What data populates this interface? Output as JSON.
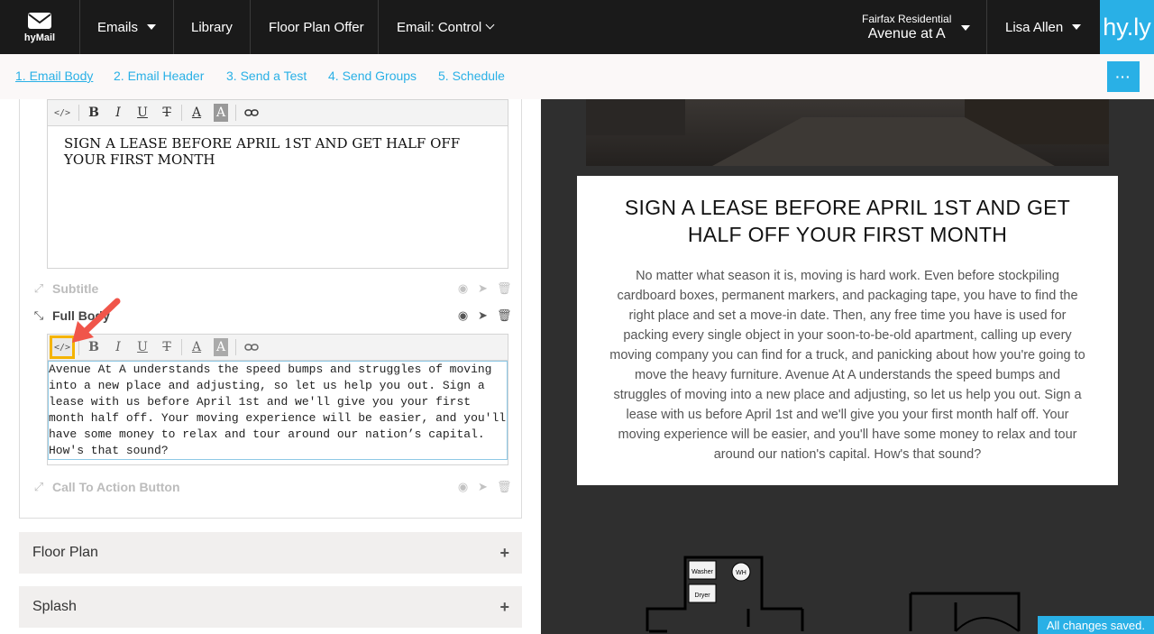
{
  "topbar": {
    "logo_label": "hyMail",
    "emails_label": "Emails",
    "library_label": "Library",
    "offer_label": "Floor Plan Offer",
    "email_variant_label": "Email: Control",
    "org_name": "Fairfax Residential",
    "property_name": "Avenue at A",
    "user_name": "Lisa Allen",
    "brand": "hy.ly"
  },
  "tabs": [
    {
      "label": "1. Email Body",
      "active": true
    },
    {
      "label": "2. Email Header",
      "active": false
    },
    {
      "label": "3. Send a Test",
      "active": false
    },
    {
      "label": "4. Send Groups",
      "active": false
    },
    {
      "label": "5. Schedule",
      "active": false
    }
  ],
  "more_button": "···",
  "editor": {
    "title_text": "SIGN A LEASE BEFORE APRIL 1ST AND GET HALF OFF YOUR FIRST MONTH",
    "fields": {
      "subtitle": "Subtitle",
      "full_body": "Full Body",
      "cta": "Call To Action Button"
    },
    "body_source": "Avenue At A understands the speed bumps and struggles of moving into a new place and adjusting, so let us help you out. Sign a lease with us before April 1st and we'll give you your first month half off. Your moving experience will be easier, and you'll have some money to relax and tour around our nation’s capital. How's that sound?",
    "toolbar": {
      "code": "</>",
      "bold": "B",
      "italic": "I",
      "underline": "U",
      "strike": "T",
      "font_color": "A",
      "bg_color": "A"
    }
  },
  "accordions": [
    "Floor Plan",
    "Splash"
  ],
  "accordion_plus": "+",
  "preview": {
    "headline": "SIGN A LEASE BEFORE APRIL 1ST AND GET HALF OFF YOUR FIRST MONTH",
    "body": "No matter what season it is, moving is hard work. Even before stockpiling cardboard boxes, permanent markers, and packaging tape, you have to find the right place and set a move-in date. Then, any free time you have is used for packing every single object in your soon-to-be-old apartment, calling up every moving company you can find for a truck, and panicking about how you're going to move the heavy furniture. Avenue At A understands the speed bumps and struggles of moving into a new place and adjusting, so let us help you out. Sign a lease with us before April 1st and we'll give you your first month half off. Your moving experience will be easier, and you'll have some money to relax and tour around our nation's capital. How's that sound?",
    "floorplan_labels": [
      "Washer",
      "WH",
      "Dryer"
    ]
  },
  "status": "All changes saved.",
  "colors": {
    "accent": "#29b0e6",
    "topbar": "#1a1a1a",
    "highlight": "#f5b400",
    "arrow": "#f0554a"
  }
}
